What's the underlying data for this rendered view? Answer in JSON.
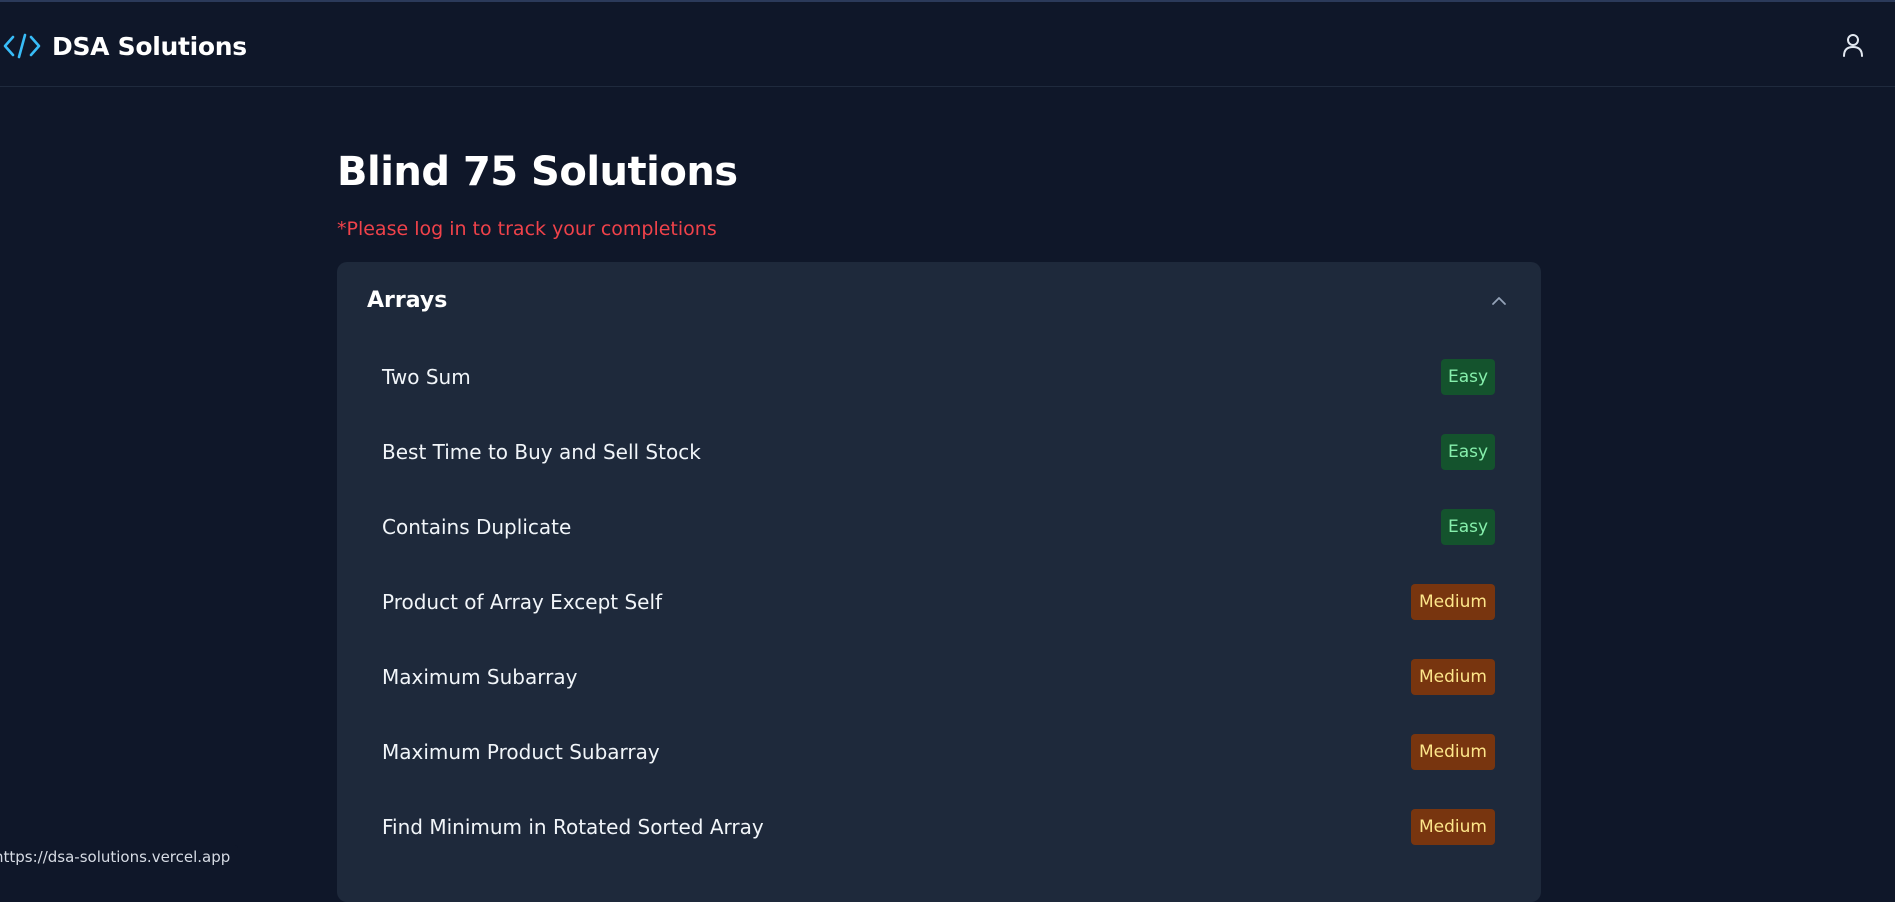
{
  "header": {
    "brand_text": "DSA Solutions",
    "brand_icon": "code-icon",
    "user_icon": "user-icon"
  },
  "main": {
    "title": "Blind 75 Solutions",
    "login_note": "*Please log in to track your completions"
  },
  "sections": [
    {
      "title": "Arrays",
      "expanded": true,
      "items": [
        {
          "name": "Two Sum",
          "difficulty": "Easy"
        },
        {
          "name": "Best Time to Buy and Sell Stock",
          "difficulty": "Easy"
        },
        {
          "name": "Contains Duplicate",
          "difficulty": "Easy"
        },
        {
          "name": "Product of Array Except Self",
          "difficulty": "Medium"
        },
        {
          "name": "Maximum Subarray",
          "difficulty": "Medium"
        },
        {
          "name": "Maximum Product Subarray",
          "difficulty": "Medium"
        },
        {
          "name": "Find Minimum in Rotated Sorted Array",
          "difficulty": "Medium"
        }
      ]
    }
  ],
  "colors": {
    "background": "#0f1729",
    "panel": "#1e293b",
    "accent": "#38bdf8",
    "warning_text": "#f0424a",
    "easy_bg": "#14532d",
    "easy_text": "#86efac",
    "medium_bg": "#78350f",
    "medium_text": "#fde68a"
  },
  "status_bar": {
    "url": "https://dsa-solutions.vercel.app"
  }
}
